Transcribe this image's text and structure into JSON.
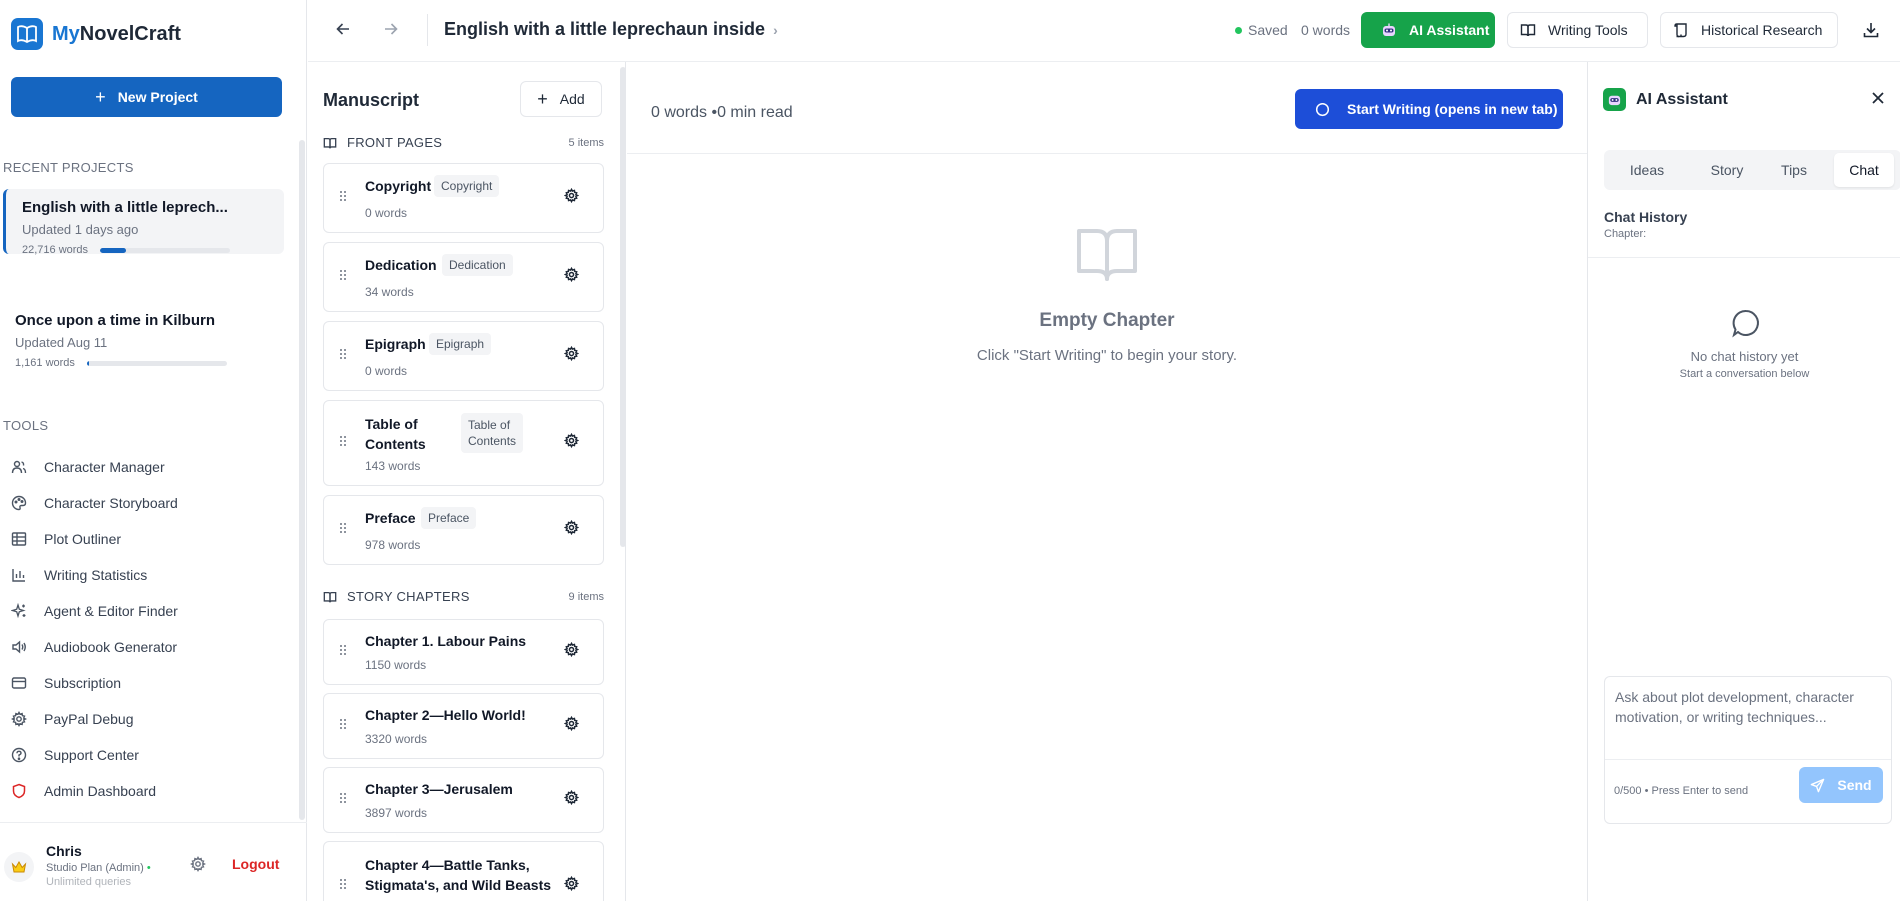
{
  "app": {
    "brand_prefix": "My",
    "brand_name": "NovelCraft"
  },
  "sidebar": {
    "new_project_label": "New Project",
    "recent_label": "RECENT PROJECTS",
    "projects": [
      {
        "title": "English with a little leprech...",
        "updated": "Updated 1 days ago",
        "words": "22,716 words",
        "progress": 0.2
      },
      {
        "title": "Once upon a time in Kilburn",
        "updated": "Updated Aug 11",
        "words": "1,161 words",
        "progress": 0.01
      }
    ],
    "tools_label": "TOOLS",
    "tools": [
      {
        "label": "Character Manager",
        "icon": "users-icon"
      },
      {
        "label": "Character Storyboard",
        "icon": "palette-icon"
      },
      {
        "label": "Plot Outliner",
        "icon": "table-icon"
      },
      {
        "label": "Writing Statistics",
        "icon": "bar-chart-icon"
      },
      {
        "label": "Agent & Editor Finder",
        "icon": "sparkles-icon"
      },
      {
        "label": "Audiobook Generator",
        "icon": "volume-icon"
      },
      {
        "label": "Subscription",
        "icon": "credit-card-icon"
      },
      {
        "label": "PayPal Debug",
        "icon": "gear-icon"
      },
      {
        "label": "Support Center",
        "icon": "help-circle-icon"
      },
      {
        "label": "Admin Dashboard",
        "icon": "shield-icon"
      }
    ],
    "user": {
      "name": "Chris",
      "plan": "Studio Plan (Admin)",
      "queries": "Unlimited queries",
      "logout_label": "Logout"
    }
  },
  "topbar": {
    "title": "English with a little leprechaun inside",
    "saved_label": "Saved",
    "words_label": "0 words",
    "ai_button": "AI Assistant",
    "writing_tools_button": "Writing Tools",
    "historical_button": "Historical Research"
  },
  "manuscript": {
    "title": "Manuscript",
    "add_label": "Add",
    "front_label": "FRONT PAGES",
    "front_count": "5 items",
    "front_pages": [
      {
        "name": "Copyright",
        "tag": "Copyright",
        "words": "0 words"
      },
      {
        "name": "Dedication",
        "tag": "Dedication",
        "words": "34 words"
      },
      {
        "name": "Epigraph",
        "tag": "Epigraph",
        "words": "0 words"
      },
      {
        "name_line1": "Table of",
        "name_line2": "Contents",
        "tag_line1": "Table of",
        "tag_line2": "Contents",
        "words": "143 words"
      },
      {
        "name": "Preface",
        "tag": "Preface",
        "words": "978 words"
      }
    ],
    "story_label": "STORY CHAPTERS",
    "story_count": "9 items",
    "chapters": [
      {
        "name": "Chapter 1. Labour Pains",
        "words": "1150 words"
      },
      {
        "name": "Chapter 2—Hello World!",
        "words": "3320 words"
      },
      {
        "name": "Chapter 3—Jerusalem",
        "words": "3897 words"
      },
      {
        "name_line1": "Chapter 4—Battle Tanks,",
        "name_line2": "Stigmata's, and Wild Beasts"
      }
    ]
  },
  "editor": {
    "stats": "0 words •0 min read",
    "start_button": "Start Writing (opens in new tab)",
    "empty_title": "Empty Chapter",
    "empty_subtitle": "Click \"Start Writing\" to begin your story."
  },
  "ai_panel": {
    "title": "AI Assistant",
    "tabs": [
      "Ideas",
      "Story",
      "Tips",
      "Chat"
    ],
    "active_tab": "Chat",
    "history_title": "Chat History",
    "history_sub": "Chapter:",
    "empty_title": "No chat history yet",
    "empty_sub": "Start a conversation below",
    "input_placeholder": "Ask about plot development, character motivation, or writing techniques...",
    "char_count": "0/500 • Press Enter to send",
    "send_label": "Send"
  },
  "colors": {
    "primary": "#1565c0",
    "success": "#16a34a",
    "danger": "#dc2626",
    "start_button": "#1d4ed8"
  }
}
